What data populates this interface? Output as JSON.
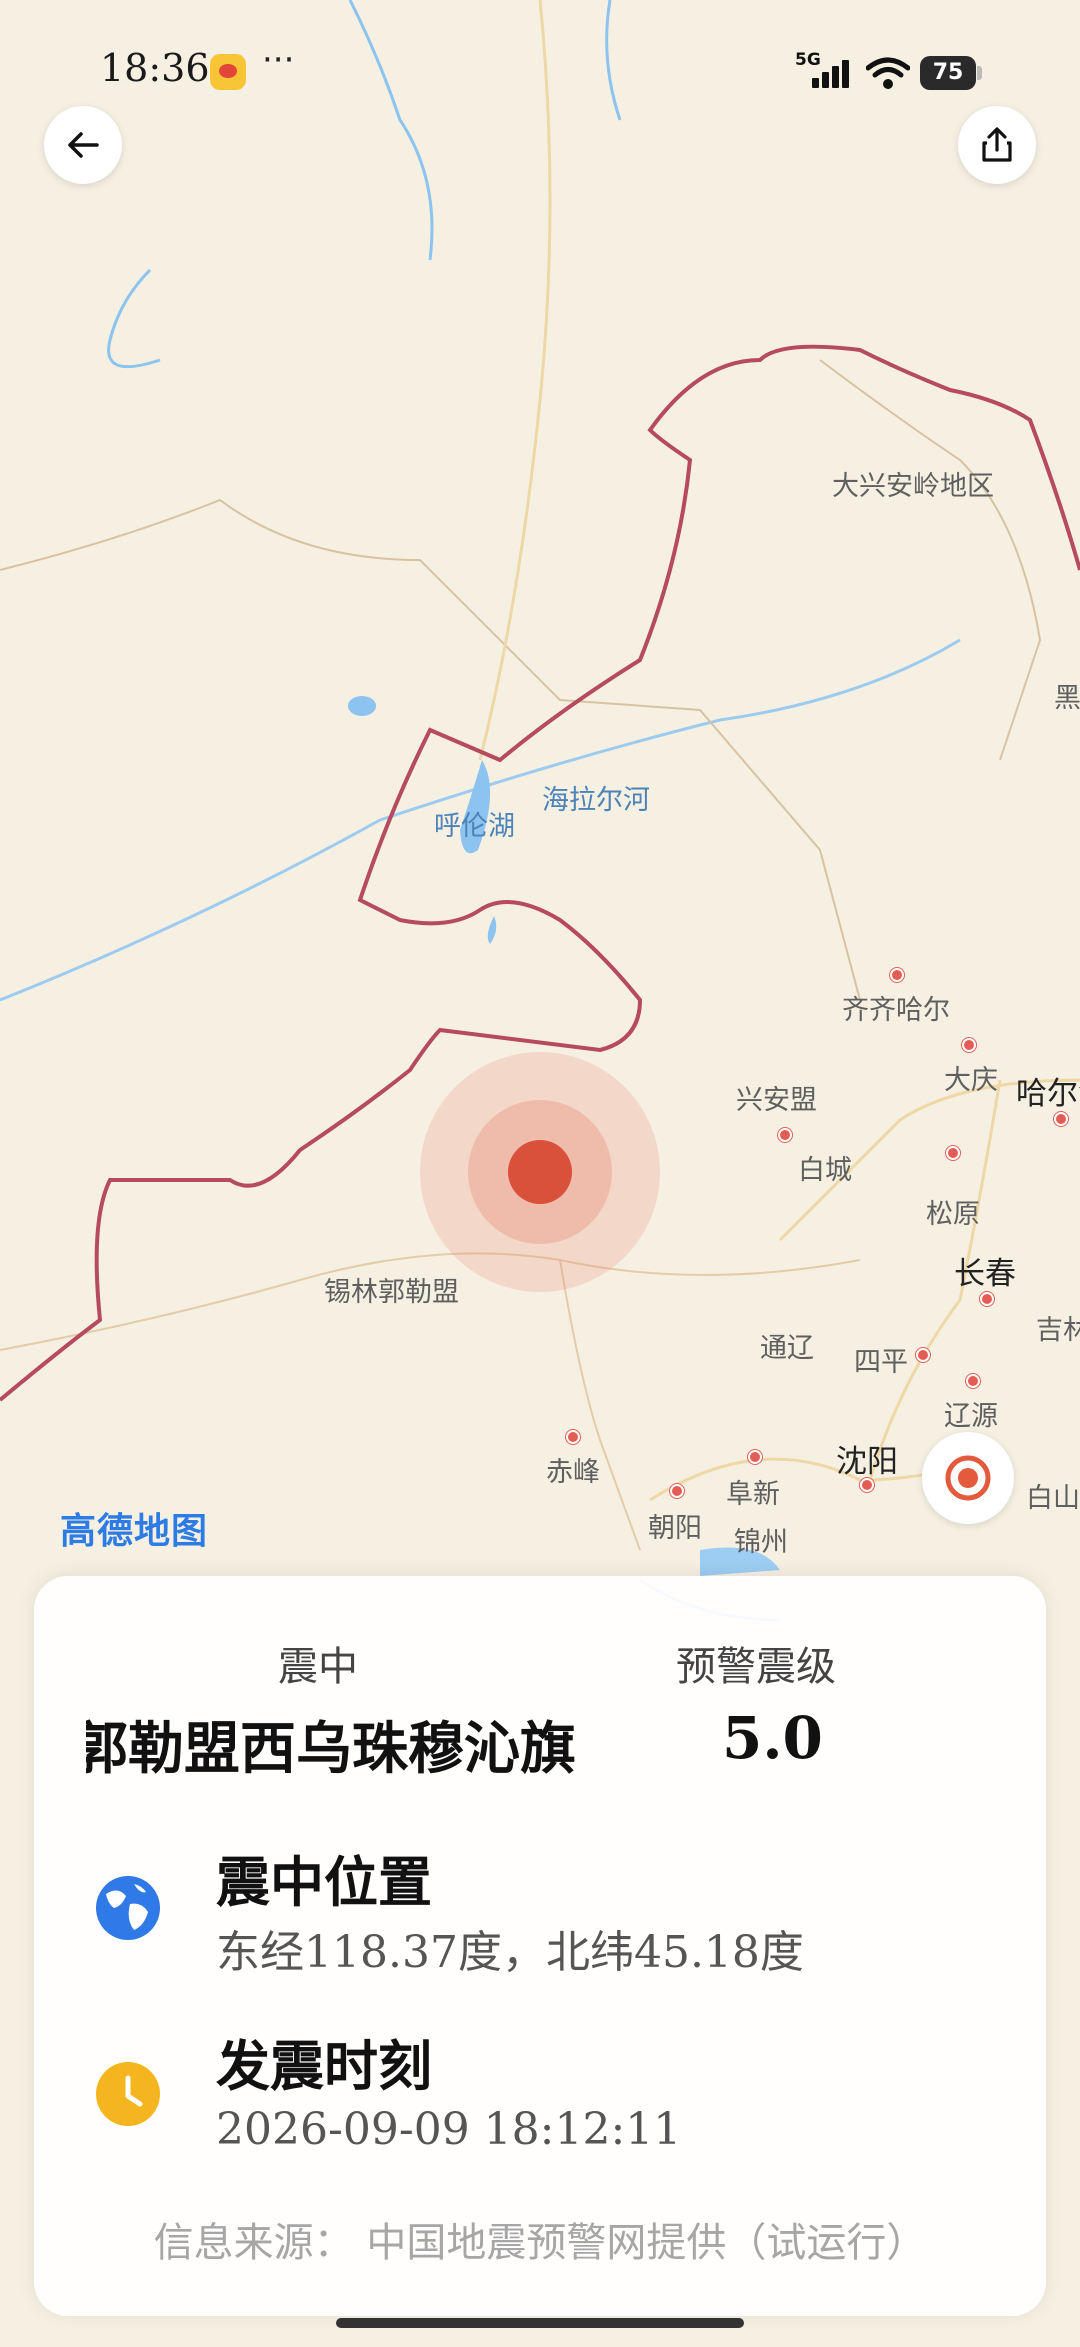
{
  "status_bar": {
    "time": "18:36",
    "dots": "···",
    "network": "5G",
    "battery": "75"
  },
  "map": {
    "labels": {
      "daxinganling": "大兴安岭地区",
      "hei": "黑",
      "hulun_lake": "呼伦湖",
      "hailar_river": "海拉尔河",
      "qiqihar": "齐齐哈尔",
      "daqing": "大庆",
      "harbin": "哈尔滨",
      "xinganmeng": "兴安盟",
      "baicheng": "白城",
      "songyuan": "松原",
      "changchun": "长春",
      "jilin": "吉林",
      "xilingol": "锡林郭勒盟",
      "tongliao": "通辽",
      "siping": "四平",
      "liaoyuan": "辽源",
      "chifeng": "赤峰",
      "shenyang": "沈阳",
      "fuxin": "阜新",
      "baishan": "白山",
      "chaoyang": "朝阳",
      "jinzhou": "锦州"
    },
    "logo": "高德地图"
  },
  "card": {
    "epicenter_label": "震中",
    "magnitude_label": "预警震级",
    "epicenter_name": "锡林郭勒盟西乌珠穆沁旗",
    "magnitude": "5.0",
    "location_title": "震中位置",
    "location_value": "东经118.37度，北纬45.18度",
    "time_title": "发震时刻",
    "time_value": "2026-09-09  18:12:11",
    "source": "信息来源：  中国地震预警网提供（试运行）"
  },
  "colors": {
    "map_background": "#f6f0e3",
    "border": "#b64a5f",
    "water": "#8cc3ef",
    "epicenter": "#d9513a",
    "globe": "#2f7ae6",
    "clock": "#f4b51f"
  },
  "icons": [
    "back-arrow-icon",
    "share-icon",
    "locate-icon",
    "globe-icon",
    "clock-icon"
  ]
}
